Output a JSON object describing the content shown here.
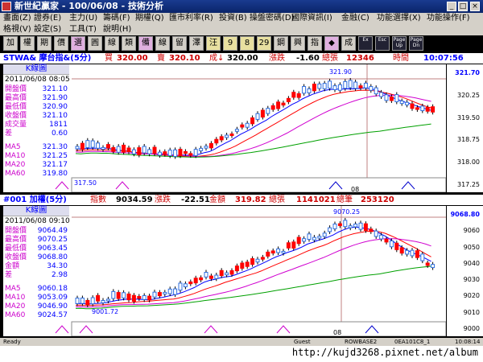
{
  "window": {
    "title": "新世紀贏家 - 100/06/08 - 技術分析"
  },
  "menu1": [
    "畫面(Z)",
    "證券(E)",
    "主力(U)",
    "籌碼(F)",
    "期權(Q)",
    "匯市利率(R)",
    "投資(B)",
    "操盤密碼(D)",
    "國際資訊(I)",
    "金融(C)",
    "功能選擇(X)",
    "功能操作(F)"
  ],
  "menu2": [
    "格視(V)",
    "設定(S)",
    "工具(T)",
    "說明(H)"
  ],
  "toolbar": [
    "加",
    "權",
    "期",
    "價",
    "選",
    "圓",
    "線",
    "類",
    "備",
    "線",
    "留",
    "澤",
    "汪",
    "9",
    "8",
    "29",
    "鋼",
    "興",
    "指",
    "◆",
    "成",
    "Ex",
    "Esc",
    "Page Up",
    "Page Dn"
  ],
  "panel1": {
    "header": {
      "name": "STWA& 摩台指&(5分)",
      "buy_label": "買",
      "buy": "320.00",
      "sell_label": "賣",
      "sell": "320.10",
      "last_label": "成↓",
      "last": "320.00",
      "chg_label": "漲跌",
      "chg": "-1.60",
      "vol_label": "總張",
      "vol": "12346",
      "time_label": "時間",
      "time": "10:07:56"
    },
    "info_title": "K線圖",
    "info_date": "2011/06/08 08:05",
    "info_rows": [
      {
        "label": "開盤價",
        "value": "321.10"
      },
      {
        "label": "最高價",
        "value": "321.90"
      },
      {
        "label": "最低價",
        "value": "320.90"
      },
      {
        "label": "收盤價",
        "value": "321.10"
      },
      {
        "label": "成交量",
        "value": "1811"
      },
      {
        "label": "差",
        "value": "0.60"
      }
    ],
    "ma_rows": [
      {
        "label": "MA5",
        "value": "321.30"
      },
      {
        "label": "MA10",
        "value": "321.25"
      },
      {
        "label": "MA20",
        "value": "321.17"
      },
      {
        "label": "MA60",
        "value": "319.80"
      }
    ],
    "high_label": "321.90",
    "low_label": "317.50",
    "y_ticks": [
      "321.70",
      "320.25",
      "319.50",
      "318.75",
      "318.00",
      "317.25"
    ],
    "x_label": "08"
  },
  "panel2": {
    "header": {
      "name": "#001 加權(5分)",
      "idx_label": "指數",
      "idx": "9034.59",
      "chg_label": "漲跌",
      "chg": "-22.51",
      "amt_label": "金額",
      "amt": "319.82",
      "vol_label": "總張",
      "vol": "1141021",
      "cnt_label": "總筆",
      "cnt": "253120"
    },
    "info_title": "K線圖",
    "info_date": "2011/06/08 09:10",
    "info_rows": [
      {
        "label": "開盤價",
        "value": "9064.49"
      },
      {
        "label": "最高價",
        "value": "9070.25"
      },
      {
        "label": "最低價",
        "value": "9063.45"
      },
      {
        "label": "收盤價",
        "value": "9068.80"
      },
      {
        "label": "金額",
        "value": "34.30"
      },
      {
        "label": "差",
        "value": "2.98"
      }
    ],
    "ma_rows": [
      {
        "label": "MA5",
        "value": "9060.18"
      },
      {
        "label": "MA10",
        "value": "9053.09"
      },
      {
        "label": "MA20",
        "value": "9046.90"
      },
      {
        "label": "MA60",
        "value": "9024.57"
      }
    ],
    "high_label": "9070.25",
    "low_label": "9001.72",
    "y_ticks": [
      "9068.80",
      "9060",
      "9050",
      "9040",
      "9030",
      "9020",
      "9010",
      "9000"
    ],
    "x_label": "08"
  },
  "status": {
    "left": "Ready",
    "guest": "Guest",
    "code": "ROWBASE2",
    "id": "0EA101C8_1",
    "time": "10:08:14"
  },
  "watermark": "http://kujd3268.pixnet.net/album",
  "colors": {
    "up": "#ff0000",
    "down": "#0000ff",
    "ma5": "#0000ff",
    "ma10": "#ff0000",
    "ma20": "#d000d0",
    "ma60": "#00a000"
  }
}
